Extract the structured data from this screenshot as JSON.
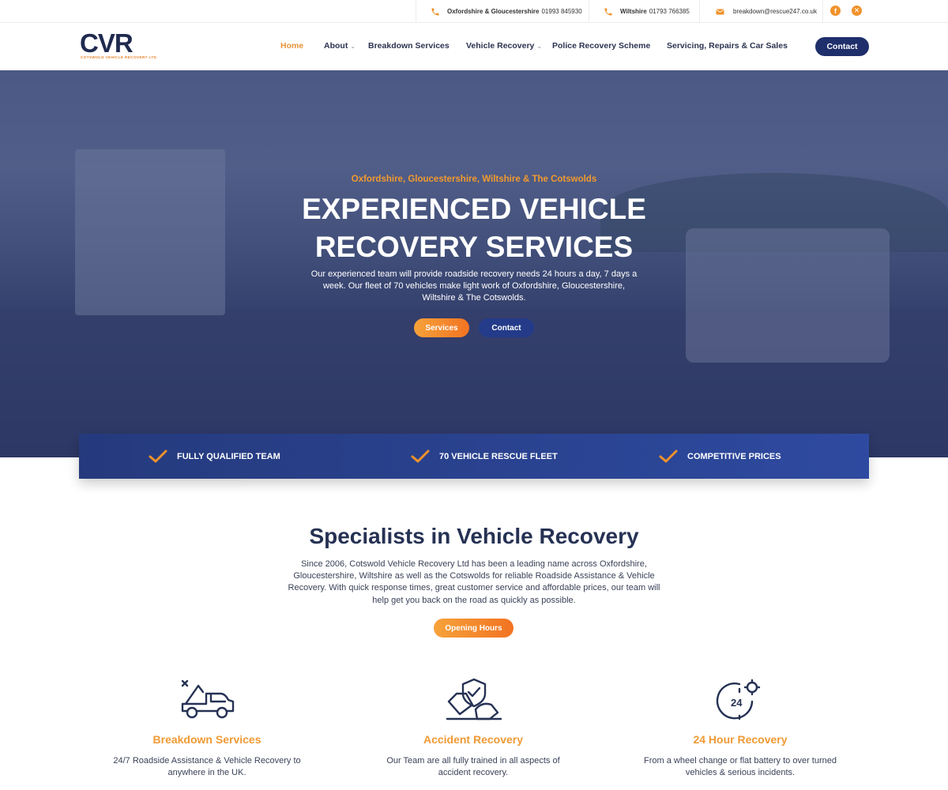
{
  "topbar": {
    "phone1_region": "Oxfordshire & Gloucestershire",
    "phone1_number": "01993 845930",
    "phone2_region": "Wiltshire",
    "phone2_number": "01793 766385",
    "email": "breakdown@rescue247.co.uk",
    "social_icons": [
      "facebook-icon",
      "website-icon"
    ]
  },
  "logo": {
    "mark": "CVR",
    "tagline": "COTSWOLD VEHICLE RECOVERY LTD"
  },
  "nav": {
    "items": [
      {
        "label": "Home",
        "active": true
      },
      {
        "label": "About",
        "dropdown": true
      },
      {
        "label": "Breakdown Services"
      },
      {
        "label": "Vehicle Recovery",
        "dropdown": true
      },
      {
        "label": "Police Recovery Scheme"
      },
      {
        "label": "Servicing, Repairs & Car Sales"
      }
    ],
    "contact_label": "Contact"
  },
  "hero": {
    "tagline": "Oxfordshire,  Gloucestershire, Wiltshire & The Cotswolds",
    "title": "EXPERIENCED VEHICLE RECOVERY SERVICES",
    "text": "Our experienced team will provide roadside recovery needs 24 hours a day, 7 days a week. Our fleet of 70 vehicles make light work of Oxfordshire, Gloucestershire, Wiltshire & The Cotswolds.",
    "services_label": "Services",
    "contact_label": "Contact"
  },
  "features": [
    {
      "label": "FULLY QUALIFIED TEAM"
    },
    {
      "label": "70 VEHICLE RESCUE FLEET"
    },
    {
      "label": "COMPETITIVE PRICES"
    }
  ],
  "specialists": {
    "title": "Specialists in Vehicle Recovery",
    "text": "Since 2006, Cotswold Vehicle Recovery Ltd has been a leading name across Oxfordshire, Gloucestershire, Wiltshire as well as the Cotswolds for reliable Roadside Assistance & Vehicle Recovery. With quick response times, great customer service and affordable prices, our team will help get you back on the road as quickly as possible.",
    "button_label": "Opening Hours"
  },
  "services": [
    {
      "icon": "tow-truck-icon",
      "title": "Breakdown Services",
      "text": "24/7 Roadside Assistance & Vehicle Recovery to anywhere in the UK."
    },
    {
      "icon": "crashed-car-shield-icon",
      "title": "Accident Recovery",
      "text": "Our Team are all fully trained in all aspects of accident recovery."
    },
    {
      "icon": "24-hour-clock-icon",
      "title": "24 Hour Recovery",
      "text": "From a wheel change or flat battery to over turned vehicles & serious incidents."
    }
  ],
  "colors": {
    "accent": "#f0922b",
    "navy": "#1f2f6b",
    "band": "#2a4290"
  }
}
